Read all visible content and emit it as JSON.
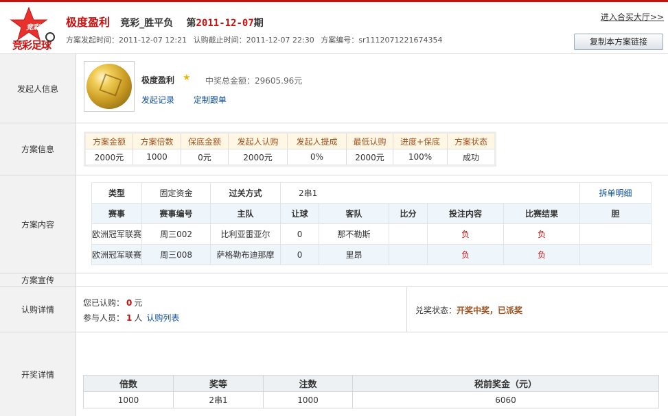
{
  "header": {
    "logo_top": "竞彩",
    "logo_bottom": "竞彩足球",
    "scheme_name": "极度盈利",
    "game_type": "竞彩_胜平负",
    "issue_prefix": "第",
    "issue_date": "2011-12-07",
    "issue_suffix": "期",
    "launch_time": "方案发起时间：2011-12-07 12:21",
    "deadline": "认购截止时间：2011-12-07 22:30",
    "scheme_id": "方案编号：sr1112071221674354",
    "hall_link": "进入合买大厅>>",
    "copy_button": "复制本方案链接"
  },
  "initiator": {
    "label": "发起人信息",
    "name": "极度盈利",
    "total": "中奖总金额：29605.96元",
    "links": [
      "发起记录",
      "定制跟单"
    ]
  },
  "scheme_info": {
    "label": "方案信息",
    "headers": [
      "方案金额",
      "方案倍数",
      "保底金额",
      "发起人认购",
      "发起人提成",
      "最低认购",
      "进度+保底",
      "方案状态"
    ],
    "values": [
      "2000元",
      "1000",
      "0元",
      "2000元",
      "0%",
      "2000元",
      "100%",
      "成功"
    ],
    "colors": {
      "accent": "#c8100f",
      "header_text": "#a0521f",
      "header_bg": "#fff6e4"
    }
  },
  "scheme_content": {
    "label": "方案内容",
    "type_label": "类型",
    "type_value": "固定资金",
    "pass_label": "过关方式",
    "pass_value": "2串1",
    "split_link": "拆单明细",
    "columns": [
      "赛事",
      "赛事编号",
      "主队",
      "让球",
      "客队",
      "比分",
      "投注内容",
      "比赛结果",
      "胆"
    ],
    "rows": [
      [
        "欧洲冠军联赛",
        "周三002",
        "比利亚雷亚尔",
        "0",
        "那不勒斯",
        "",
        "负",
        "负",
        ""
      ],
      [
        "欧洲冠军联赛",
        "周三008",
        "萨格勒布迪那摩",
        "0",
        "里昂",
        "",
        "负",
        "负",
        ""
      ]
    ]
  },
  "promotion": {
    "label": "方案宣传"
  },
  "subscription": {
    "label": "认购详情",
    "subscribed_prefix": "您已认购：",
    "subscribed_value": "0",
    "subscribed_suffix": "元",
    "participants_prefix": "参与人员：",
    "participants_value": "1",
    "participants_suffix": "人",
    "list_link": "认购列表",
    "status_prefix": "兑奖状态：",
    "status_value": "开奖中奖，已派奖"
  },
  "lottery": {
    "label": "开奖详情",
    "headers": [
      "倍数",
      "奖等",
      "注数",
      "税前奖金（元）"
    ],
    "values": [
      "1000",
      "2串1",
      "1000",
      "6060"
    ]
  }
}
